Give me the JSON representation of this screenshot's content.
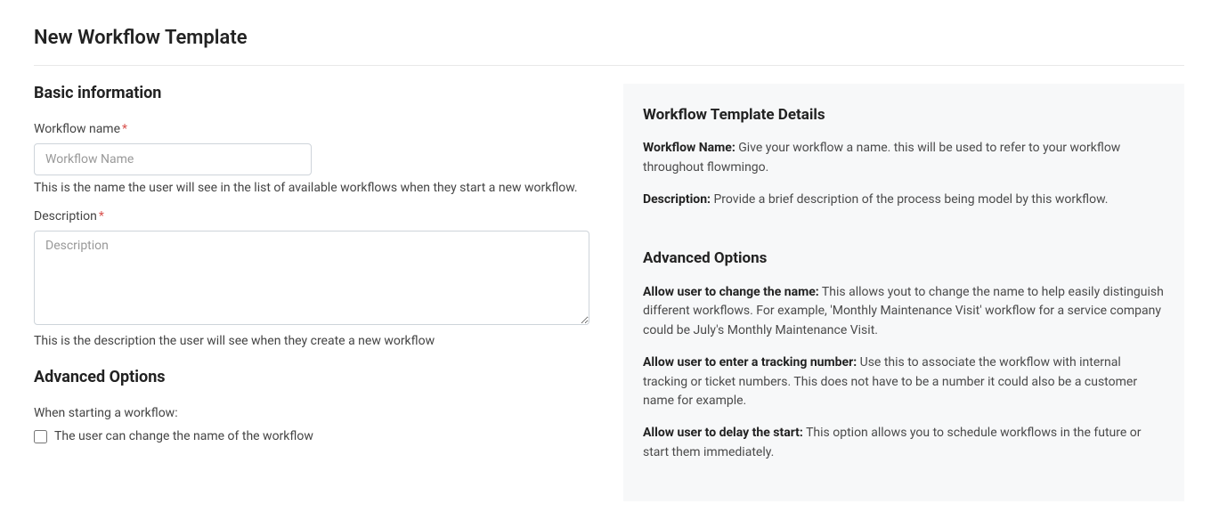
{
  "page_title": "New Workflow Template",
  "basic_info": {
    "heading": "Basic information",
    "workflow_name": {
      "label": "Workflow name",
      "placeholder": "Workflow Name",
      "help": "This is the name the user will see in the list of available workflows when they start a new workflow."
    },
    "description": {
      "label": "Description",
      "placeholder": "Description",
      "help": "This is the description the user will see when they create a new workflow"
    }
  },
  "advanced_options": {
    "heading": "Advanced Options",
    "subheading": "When starting a workflow:",
    "checkbox_change_name": "The user can change the name of the workflow"
  },
  "details_panel": {
    "heading1": "Workflow Template Details",
    "wf_name_bold": "Workflow Name:",
    "wf_name_text": " Give your workflow a name. this will be used to refer to your workflow throughout flowmingo.",
    "desc_bold": "Description:",
    "desc_text": " Provide a brief description of the process being model by this workflow.",
    "heading2": "Advanced Options",
    "opt1_bold": "Allow user to change the name:",
    "opt1_text": " This allows yout to change the name to help easily distinguish different workflows. For example, 'Monthly Maintenance Visit' workflow for a service company could be July's Monthly Maintenance Visit.",
    "opt2_bold": "Allow user to enter a tracking number:",
    "opt2_text": " Use this to associate the workflow with internal tracking or ticket numbers. This does not have to be a number it could also be a customer name for example.",
    "opt3_bold": "Allow user to delay the start:",
    "opt3_text": " This option allows you to schedule workflows in the future or start them immediately."
  }
}
